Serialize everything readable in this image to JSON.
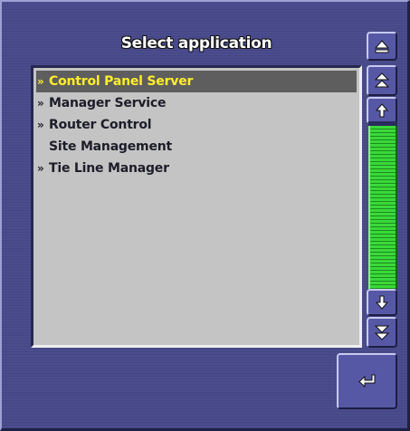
{
  "dialog": {
    "title": "Select application"
  },
  "list": {
    "items": [
      {
        "marker": "»",
        "label": "Control Panel Server",
        "selected": true
      },
      {
        "marker": "»",
        "label": "Manager Service",
        "selected": false
      },
      {
        "marker": "»",
        "label": "Router Control",
        "selected": false
      },
      {
        "marker": "",
        "label": "Site Management",
        "selected": false
      },
      {
        "marker": "»",
        "label": "Tie Line Manager",
        "selected": false
      }
    ]
  },
  "icons": {
    "eject": "eject-icon",
    "scroll_top": "double-chevron-up-icon",
    "scroll_up": "arrow-up-icon",
    "scroll_down": "arrow-down-icon",
    "scroll_bottom": "double-chevron-down-icon",
    "enter": "enter-return-icon"
  },
  "colors": {
    "panel_background": "#4a4c8e",
    "list_background": "#c4c4c4",
    "selection_background": "#5e5e5e",
    "selection_text": "#ffee2a",
    "scroll_thumb": "#33c533"
  },
  "scrollbar": {
    "thumb_fraction": 1.0
  }
}
